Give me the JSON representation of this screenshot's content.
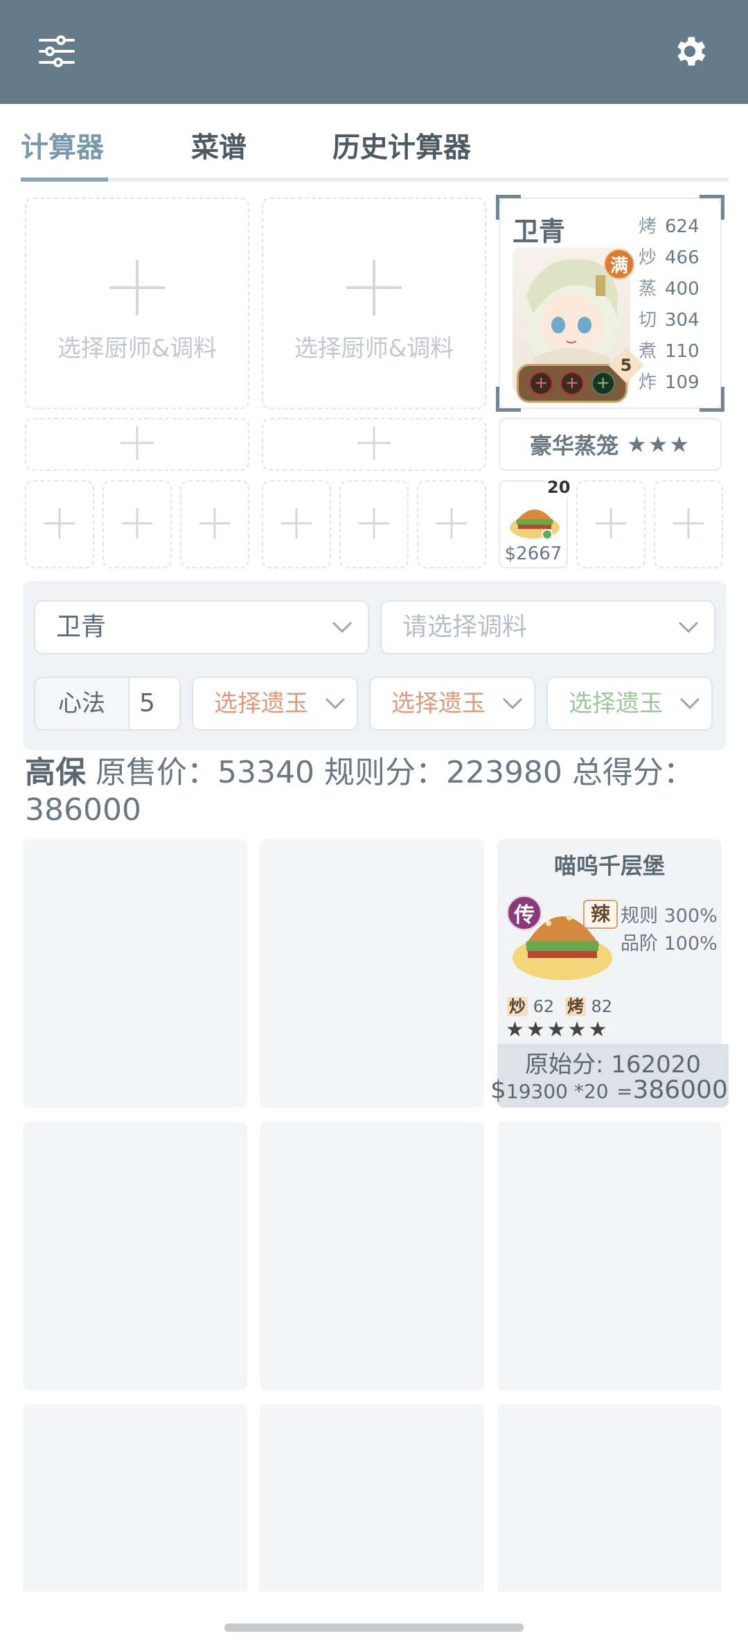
{
  "header": {
    "menu_icon": "sliders-icon",
    "settings_icon": "gear-icon"
  },
  "tabs": [
    {
      "label": "计算器",
      "active": true
    },
    {
      "label": "菜谱",
      "active": false
    },
    {
      "label": "历史计算器",
      "active": false
    }
  ],
  "chef_slots": [
    {
      "label": "选择厨师&调料"
    },
    {
      "label": "选择厨师&调料"
    }
  ],
  "chef": {
    "name": "卫青",
    "full_badge": "满",
    "level": "5",
    "stats": [
      {
        "k": "烤",
        "v": "624"
      },
      {
        "k": "炒",
        "v": "466"
      },
      {
        "k": "蒸",
        "v": "400"
      },
      {
        "k": "切",
        "v": "304"
      },
      {
        "k": "煮",
        "v": "110"
      },
      {
        "k": "炸",
        "v": "109"
      }
    ],
    "equipment": "豪华蒸笼",
    "equipment_stars": "★★★",
    "recipe_count": "20",
    "recipe_price": "$2667"
  },
  "controls": {
    "chef_select": "卫青",
    "seasoning_placeholder": "请选择调料",
    "xinfa_label": "心法",
    "xinfa_value": "5",
    "jade_1": "选择遗玉",
    "jade_2": "选择遗玉",
    "jade_3": "选择遗玉",
    "colors": {
      "jade_red": "#e0997a",
      "jade_green": "#9cc79a"
    }
  },
  "summary": {
    "tag": "高保",
    "text": "原售价：53340 规则分：223980 总得分：386000"
  },
  "recipe_card": {
    "title": "喵呜千层堡",
    "rarity": "传",
    "flavor": "辣",
    "rule_line": "规则 300%",
    "grade_line": "品阶 100%",
    "tag1_k": "炒",
    "tag1_v": "62",
    "tag2_k": "烤",
    "tag2_v": "82",
    "stars": "★★★★★",
    "original_score": "原始分: 162020",
    "calc_currency": "$",
    "calc_mid": "19300 *20",
    "calc_eq": "=",
    "calc_total": "386000"
  }
}
